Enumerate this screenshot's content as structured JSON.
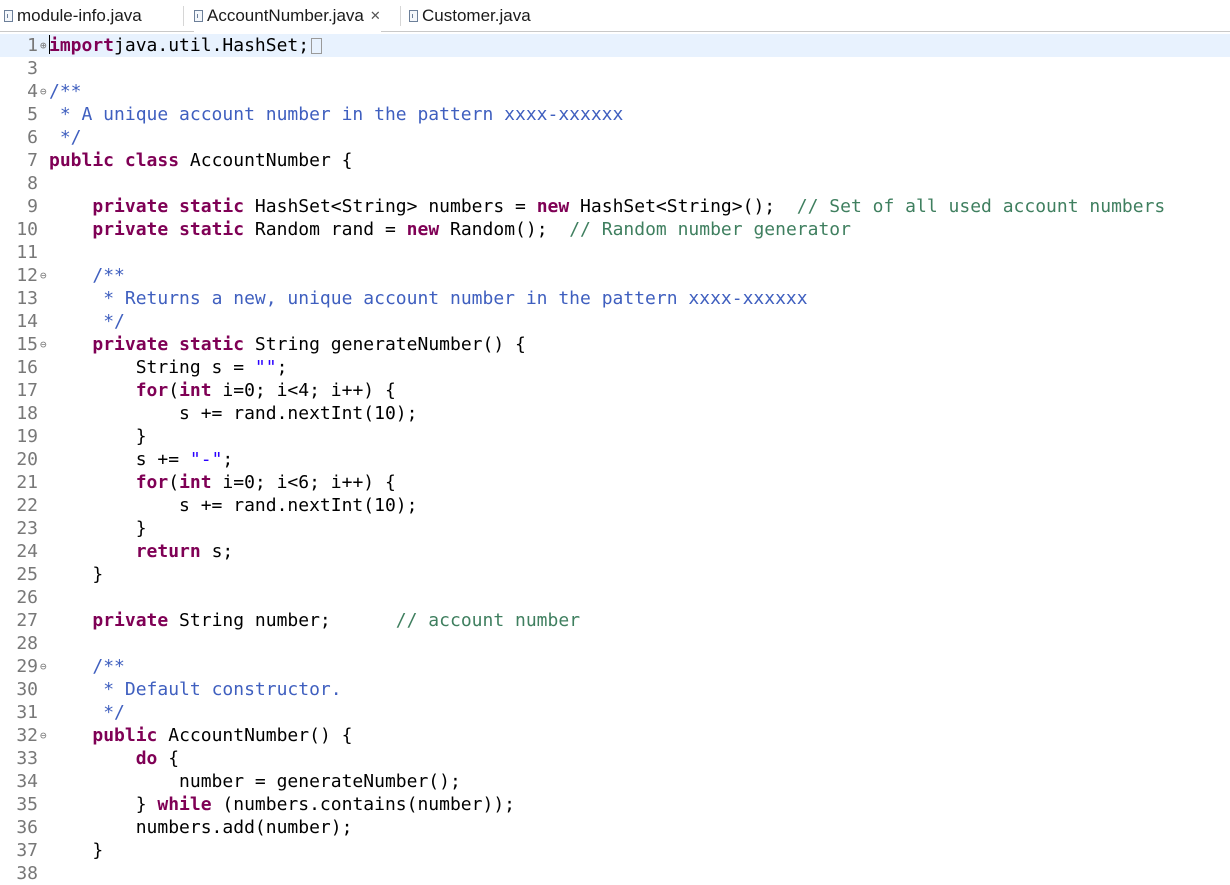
{
  "tabs": [
    {
      "label": "module-info.java",
      "active": false,
      "closable": false,
      "icon": "java-file-icon"
    },
    {
      "label": "AccountNumber.java",
      "active": true,
      "closable": true,
      "close_glyph": "✕",
      "icon": "java-file-icon"
    },
    {
      "label": "Customer.java",
      "active": false,
      "closable": false,
      "icon": "java-file-icon"
    }
  ],
  "editor": {
    "file": "AccountNumber.java",
    "current_line": 1,
    "lines": [
      {
        "n": "1",
        "fold": "⊕",
        "tokens": [
          [
            "kw",
            "import"
          ],
          [
            "",
            "java.util.HashSet;"
          ]
        ]
      },
      {
        "n": "3",
        "fold": "",
        "tokens": []
      },
      {
        "n": "4",
        "fold": "⊖",
        "tokens": [
          [
            "jd",
            "/**"
          ]
        ]
      },
      {
        "n": "5",
        "fold": "",
        "tokens": [
          [
            "jd",
            " * A unique account number in the pattern xxxx-xxxxxx"
          ]
        ]
      },
      {
        "n": "6",
        "fold": "",
        "tokens": [
          [
            "jd",
            " */"
          ]
        ]
      },
      {
        "n": "7",
        "fold": "",
        "tokens": [
          [
            "kw",
            "public"
          ],
          [
            "",
            " "
          ],
          [
            "kw",
            "class"
          ],
          [
            "",
            " AccountNumber {"
          ]
        ]
      },
      {
        "n": "8",
        "fold": "",
        "tokens": []
      },
      {
        "n": "9",
        "fold": "",
        "tokens": [
          [
            "",
            "    "
          ],
          [
            "kw",
            "private"
          ],
          [
            "",
            " "
          ],
          [
            "kw",
            "static"
          ],
          [
            "",
            " HashSet<String> numbers = "
          ],
          [
            "kw",
            "new"
          ],
          [
            "",
            " HashSet<String>();  "
          ],
          [
            "cm",
            "// Set of all used account numbers"
          ]
        ]
      },
      {
        "n": "10",
        "fold": "",
        "tokens": [
          [
            "",
            "    "
          ],
          [
            "kw",
            "private"
          ],
          [
            "",
            " "
          ],
          [
            "kw",
            "static"
          ],
          [
            "",
            " Random rand = "
          ],
          [
            "kw",
            "new"
          ],
          [
            "",
            " Random();  "
          ],
          [
            "cm",
            "// Random number generator"
          ]
        ]
      },
      {
        "n": "11",
        "fold": "",
        "tokens": []
      },
      {
        "n": "12",
        "fold": "⊖",
        "tokens": [
          [
            "",
            "    "
          ],
          [
            "jd",
            "/**"
          ]
        ]
      },
      {
        "n": "13",
        "fold": "",
        "tokens": [
          [
            "",
            "    "
          ],
          [
            "jd",
            " * Returns a new, unique account number in the pattern xxxx-xxxxxx"
          ]
        ]
      },
      {
        "n": "14",
        "fold": "",
        "tokens": [
          [
            "",
            "    "
          ],
          [
            "jd",
            " */"
          ]
        ]
      },
      {
        "n": "15",
        "fold": "⊖",
        "tokens": [
          [
            "",
            "    "
          ],
          [
            "kw",
            "private"
          ],
          [
            "",
            " "
          ],
          [
            "kw",
            "static"
          ],
          [
            "",
            " String generateNumber() {"
          ]
        ]
      },
      {
        "n": "16",
        "fold": "",
        "tokens": [
          [
            "",
            "        String s = "
          ],
          [
            "str",
            "\"\""
          ],
          [
            "",
            ";"
          ]
        ]
      },
      {
        "n": "17",
        "fold": "",
        "tokens": [
          [
            "",
            "        "
          ],
          [
            "kw",
            "for"
          ],
          [
            "",
            "("
          ],
          [
            "kw",
            "int"
          ],
          [
            "",
            " i=0; i<4; i++) {"
          ]
        ]
      },
      {
        "n": "18",
        "fold": "",
        "tokens": [
          [
            "",
            "            s += rand.nextInt(10);"
          ]
        ]
      },
      {
        "n": "19",
        "fold": "",
        "tokens": [
          [
            "",
            "        }"
          ]
        ]
      },
      {
        "n": "20",
        "fold": "",
        "tokens": [
          [
            "",
            "        s += "
          ],
          [
            "str",
            "\"-\""
          ],
          [
            "",
            ";"
          ]
        ]
      },
      {
        "n": "21",
        "fold": "",
        "tokens": [
          [
            "",
            "        "
          ],
          [
            "kw",
            "for"
          ],
          [
            "",
            "("
          ],
          [
            "kw",
            "int"
          ],
          [
            "",
            " i=0; i<6; i++) {"
          ]
        ]
      },
      {
        "n": "22",
        "fold": "",
        "tokens": [
          [
            "",
            "            s += rand.nextInt(10);"
          ]
        ]
      },
      {
        "n": "23",
        "fold": "",
        "tokens": [
          [
            "",
            "        }"
          ]
        ]
      },
      {
        "n": "24",
        "fold": "",
        "tokens": [
          [
            "",
            "        "
          ],
          [
            "kw",
            "return"
          ],
          [
            "",
            " s;"
          ]
        ]
      },
      {
        "n": "25",
        "fold": "",
        "tokens": [
          [
            "",
            "    }"
          ]
        ]
      },
      {
        "n": "26",
        "fold": "",
        "tokens": []
      },
      {
        "n": "27",
        "fold": "",
        "tokens": [
          [
            "",
            "    "
          ],
          [
            "kw",
            "private"
          ],
          [
            "",
            " String number;      "
          ],
          [
            "cm",
            "// account number"
          ]
        ]
      },
      {
        "n": "28",
        "fold": "",
        "tokens": []
      },
      {
        "n": "29",
        "fold": "⊖",
        "tokens": [
          [
            "",
            "    "
          ],
          [
            "jd",
            "/**"
          ]
        ]
      },
      {
        "n": "30",
        "fold": "",
        "tokens": [
          [
            "",
            "    "
          ],
          [
            "jd",
            " * Default constructor."
          ]
        ]
      },
      {
        "n": "31",
        "fold": "",
        "tokens": [
          [
            "",
            "    "
          ],
          [
            "jd",
            " */"
          ]
        ]
      },
      {
        "n": "32",
        "fold": "⊖",
        "tokens": [
          [
            "",
            "    "
          ],
          [
            "kw",
            "public"
          ],
          [
            "",
            " AccountNumber() {"
          ]
        ]
      },
      {
        "n": "33",
        "fold": "",
        "tokens": [
          [
            "",
            "        "
          ],
          [
            "kw",
            "do"
          ],
          [
            "",
            " {"
          ]
        ]
      },
      {
        "n": "34",
        "fold": "",
        "tokens": [
          [
            "",
            "            number = generateNumber();"
          ]
        ]
      },
      {
        "n": "35",
        "fold": "",
        "tokens": [
          [
            "",
            "        } "
          ],
          [
            "kw",
            "while"
          ],
          [
            "",
            " (numbers.contains(number));"
          ]
        ]
      },
      {
        "n": "36",
        "fold": "",
        "tokens": [
          [
            "",
            "        numbers.add(number);"
          ]
        ]
      },
      {
        "n": "37",
        "fold": "",
        "tokens": [
          [
            "",
            "    }"
          ]
        ]
      },
      {
        "n": "38",
        "fold": "",
        "tokens": []
      }
    ]
  }
}
